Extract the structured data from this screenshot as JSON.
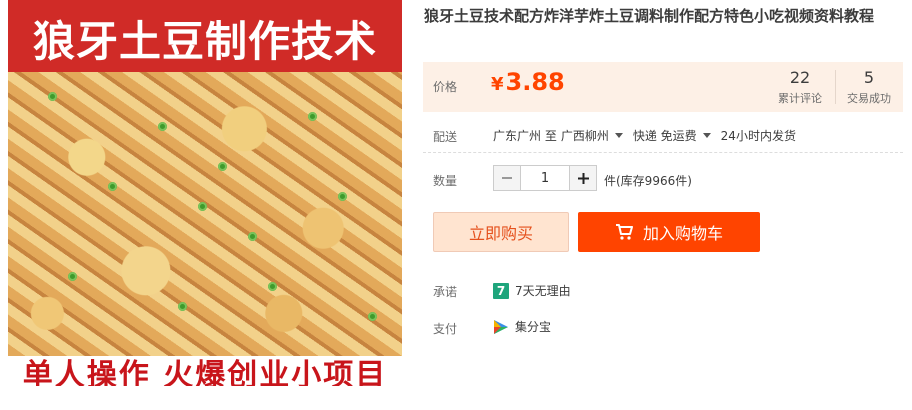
{
  "image": {
    "top_text": "狼牙土豆制作技术",
    "bottom_text": "单人操作  火爆创业小项目"
  },
  "title": "狼牙土豆技术配方炸洋芋炸土豆调料制作配方特色小吃视频资料教程",
  "price": {
    "label": "价格",
    "currency": "¥",
    "value": "3.88",
    "color": "#ff4400"
  },
  "stats": [
    {
      "value": "22",
      "label": "累计评论"
    },
    {
      "value": "5",
      "label": "交易成功"
    }
  ],
  "shipping": {
    "label": "配送",
    "from": "广东广州 至",
    "to": "广西柳州",
    "method": "快递 免运费",
    "dispatch": "24小时内发货"
  },
  "quantity": {
    "label": "数量",
    "value": "1",
    "stock": "件(库存9966件)"
  },
  "buttons": {
    "buy_now": "立即购买",
    "add_to_cart": "加入购物车"
  },
  "promise": {
    "label": "承诺",
    "badge": "7",
    "text": "7天无理由"
  },
  "payment": {
    "label": "支付",
    "text": "集分宝"
  }
}
